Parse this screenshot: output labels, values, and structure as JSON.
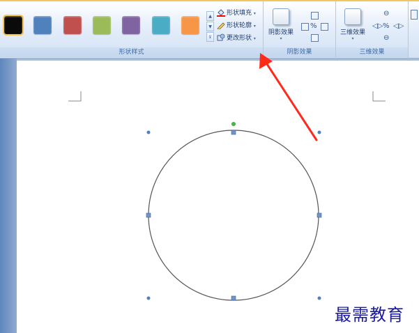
{
  "ribbon": {
    "swatches": [
      {
        "color": "#0a0a0a"
      },
      {
        "color": "#4f81bd"
      },
      {
        "color": "#c0504d"
      },
      {
        "color": "#9bbb59"
      },
      {
        "color": "#8064a2"
      },
      {
        "color": "#4bacc6"
      },
      {
        "color": "#f79646"
      }
    ],
    "shape_styles": {
      "fill_label": "形状填充",
      "outline_label": "形状轮廓",
      "change_label": "更改形状",
      "group_label": "形状样式"
    },
    "shadow": {
      "button_label": "阴影效果",
      "group_label": "阴影效果"
    },
    "threed": {
      "button_label": "三维效果",
      "group_label": "三维效果"
    }
  },
  "annotation": {
    "color": "#ff2a1a"
  },
  "shape": {
    "type": "circle",
    "stroke": "#555555",
    "handle_color": "#4f81bd",
    "rotate_handle_color": "#36c53a"
  },
  "watermark": {
    "text": "最需教育"
  }
}
